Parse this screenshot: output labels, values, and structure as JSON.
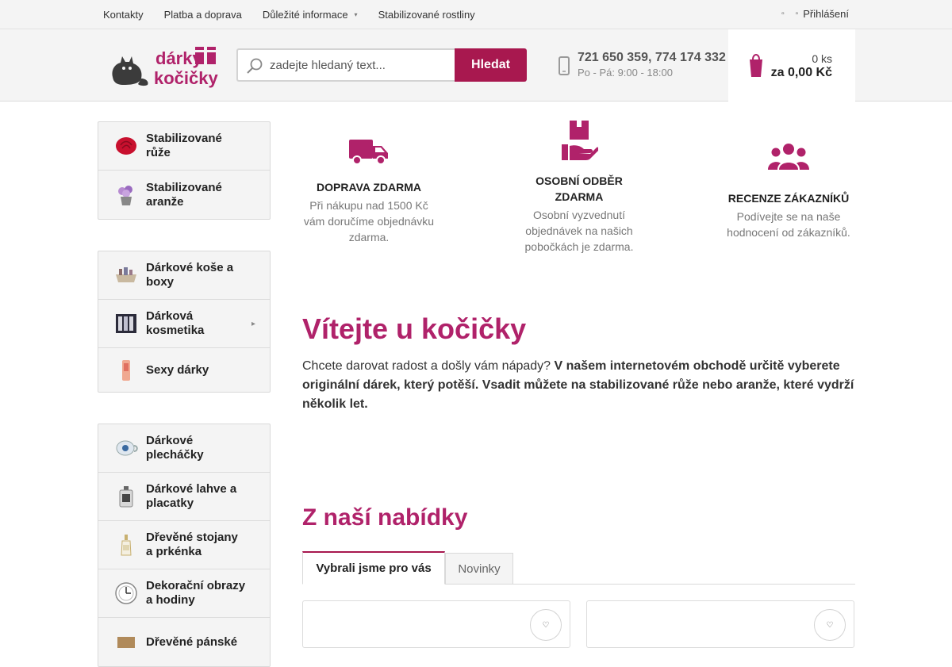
{
  "topbar": {
    "links": [
      {
        "label": "Kontakty"
      },
      {
        "label": "Platba a doprava"
      },
      {
        "label": "Důležité informace",
        "has_dropdown": true
      },
      {
        "label": "Stabilizované rostliny"
      }
    ],
    "login_label": "Přihlášení"
  },
  "header": {
    "logo_text_line1": "dárky",
    "logo_text_line2": "kočičky",
    "search": {
      "placeholder": "zadejte hledaný text...",
      "button_label": "Hledat"
    },
    "phone": {
      "numbers": "721 650 359, 774 174 332",
      "hours": "Po - Pá: 9:00 - 18:00"
    },
    "cart": {
      "quantity": "0 ks",
      "total": "za 0,00 Kč"
    }
  },
  "sidebar": {
    "groups": [
      [
        {
          "label": "Stabilizované růže",
          "thumb": "rose"
        },
        {
          "label": "Stabilizované aranže",
          "thumb": "arrangement"
        }
      ],
      [
        {
          "label": "Dárkové koše a boxy",
          "thumb": "basket"
        },
        {
          "label": "Dárková kosmetika",
          "thumb": "cosmetics",
          "has_submenu": true
        },
        {
          "label": "Sexy dárky",
          "thumb": "sexy"
        }
      ],
      [
        {
          "label": "Dárkové plecháčky",
          "thumb": "mug"
        },
        {
          "label": "Dárkové lahve a placatky",
          "thumb": "flask"
        },
        {
          "label": "Dřevěné stojany a prkénka",
          "thumb": "bottle"
        },
        {
          "label": "Dekorační obrazy a hodiny",
          "thumb": "clock"
        },
        {
          "label": "Dřevěné pánské",
          "thumb": "wood"
        }
      ]
    ]
  },
  "benefits": [
    {
      "title": "DOPRAVA ZDARMA",
      "desc": "Při nákupu nad 1500 Kč vám doručíme objednávku zdarma.",
      "icon": "truck-icon"
    },
    {
      "title": "OSOBNÍ ODBĚR ZDARMA",
      "desc": "Osobní vyzvednutí objednávek na našich pobočkách je zdarma.",
      "icon": "hand-box-icon"
    },
    {
      "title": "RECENZE ZÁKAZNÍKŮ",
      "desc": "Podívejte se na naše hodnocení od zákazníků.",
      "icon": "users-icon"
    }
  ],
  "welcome": {
    "title": "Vítejte u kočičky",
    "text_plain": "Chcete darovat radost a došly vám nápady? ",
    "text_bold": "V našem internetovém obchodě určitě vyberete originální dárek, který potěší. Vsadit můžete na stabilizované růže nebo aranže, které vydrží několik let."
  },
  "offer": {
    "title": "Z naší nabídky",
    "tabs": [
      {
        "label": "Vybrali jsme pro vás",
        "active": true
      },
      {
        "label": "Novinky",
        "active": false
      }
    ]
  },
  "colors": {
    "accent": "#a8184f",
    "heading": "#b0226a",
    "topbar_bg": "#f4f4f4"
  }
}
